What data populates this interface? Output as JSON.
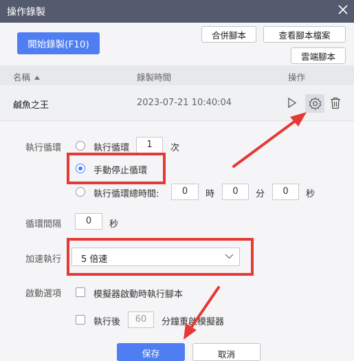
{
  "window": {
    "title": "操作錄製",
    "close_icon": "close-icon"
  },
  "toolbar": {
    "start_record": "開始錄製(F10)",
    "merge_scripts": "合併腳本",
    "view_script_files": "查看腳本檔案",
    "cloud_scripts": "雲端腳本"
  },
  "table": {
    "columns": {
      "name": "名稱",
      "record_time": "錄製時間",
      "actions": "操作"
    },
    "rows": [
      {
        "name": "鹹魚之王",
        "time": "2023-07-21 10:40:04"
      }
    ]
  },
  "settings": {
    "loop": {
      "label": "執行循環",
      "option_count_label": "執行循環",
      "count_value": "1",
      "count_unit": "次",
      "option_manual_stop": "手動停止循環",
      "option_total_time": "執行循環總時間:",
      "hours_value": "0",
      "hours_unit": "時",
      "minutes_value": "0",
      "minutes_unit": "分",
      "seconds_value": "0",
      "seconds_unit": "秒",
      "selected": "manual_stop"
    },
    "interval": {
      "label": "循環間隔",
      "value": "0",
      "unit": "秒"
    },
    "speed": {
      "label": "加速執行",
      "selected": "5 倍速"
    },
    "startup": {
      "label": "啟動選項",
      "run_on_emulator_start": "模擬器啟動時執行腳本",
      "restart_after_prefix": "執行後",
      "restart_after_value": "60",
      "restart_after_suffix": "分鐘重啟模擬器"
    }
  },
  "footer": {
    "save": "保存",
    "cancel": "取消"
  },
  "colors": {
    "accent": "#4f7df2",
    "titlebar": "#555b6e",
    "highlight": "#e53935"
  }
}
